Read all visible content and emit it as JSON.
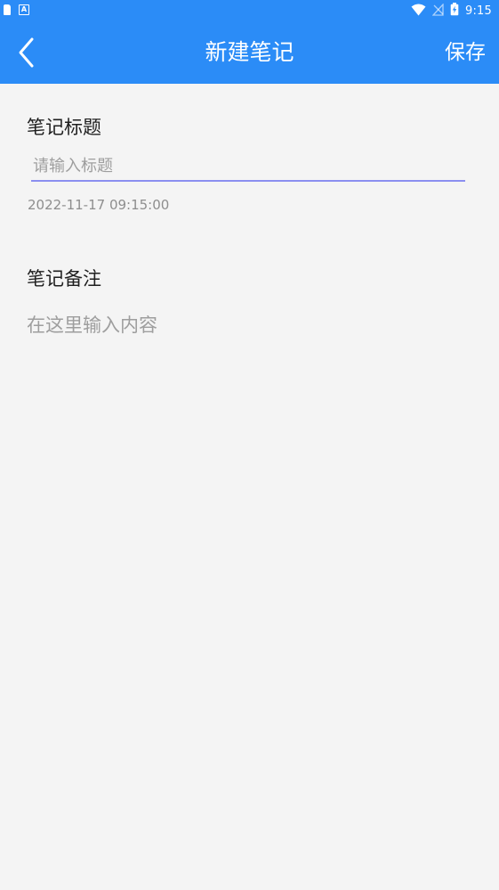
{
  "status_bar": {
    "time": "9:15",
    "left_icons": [
      "sim-card-icon",
      "app-notification-icon"
    ],
    "right_icons": [
      "wifi-icon",
      "no-signal-icon",
      "battery-charging-icon"
    ]
  },
  "app_bar": {
    "title": "新建笔记",
    "save_label": "保存",
    "back_icon": "chevron-left-icon"
  },
  "form": {
    "title_label": "笔记标题",
    "title_placeholder": "请输入标题",
    "title_value": "",
    "date": "2022-11-17 09:15:00",
    "note_label": "笔记备注",
    "note_placeholder": "在这里输入内容",
    "note_value": ""
  },
  "colors": {
    "primary": "#2b8cf7",
    "background": "#f4f4f4",
    "input_underline": "#8b8ff0"
  }
}
